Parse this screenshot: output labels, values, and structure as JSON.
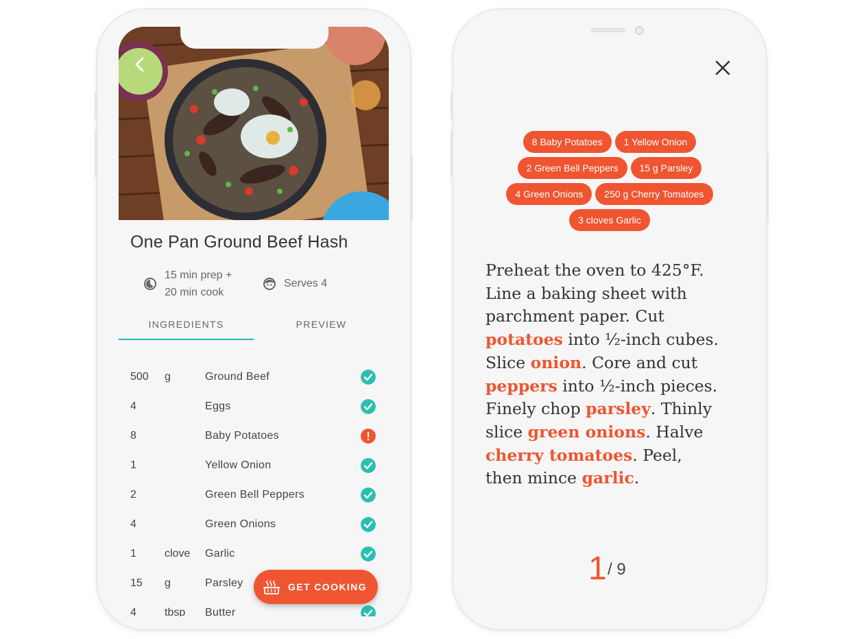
{
  "colors": {
    "accent": "#ef5530",
    "teal": "#2bbfb2"
  },
  "recipe": {
    "title": "One Pan Ground Beef Hash",
    "time_line1": "15 min prep +",
    "time_line2": "20 min cook",
    "serves": "Serves 4",
    "tabs": [
      {
        "label": "INGREDIENTS",
        "active": true
      },
      {
        "label": "PREVIEW",
        "active": false
      }
    ],
    "ingredients": [
      {
        "qty": "500",
        "unit": "g",
        "name": "Ground Beef",
        "status": "ok"
      },
      {
        "qty": "4",
        "unit": "",
        "name": "Eggs",
        "status": "ok"
      },
      {
        "qty": "8",
        "unit": "",
        "name": "Baby Potatoes",
        "status": "warn"
      },
      {
        "qty": "1",
        "unit": "",
        "name": "Yellow Onion",
        "status": "ok"
      },
      {
        "qty": "2",
        "unit": "",
        "name": "Green Bell Peppers",
        "status": "ok"
      },
      {
        "qty": "4",
        "unit": "",
        "name": "Green Onions",
        "status": "ok"
      },
      {
        "qty": "1",
        "unit": "clove",
        "name": "Garlic",
        "status": "ok"
      },
      {
        "qty": "15",
        "unit": "g",
        "name": "Parsley",
        "status": "ok"
      },
      {
        "qty": "4",
        "unit": "tbsp",
        "name": "Butter",
        "status": "ok"
      }
    ],
    "cta": "GET COOKING"
  },
  "step": {
    "chips": [
      [
        "8 Baby Potatoes",
        "1 Yellow Onion"
      ],
      [
        "2 Green Bell Peppers",
        "15 g Parsley"
      ],
      [
        "4 Green Onions",
        "250 g Cherry Tomatoes"
      ],
      [
        "3 cloves Garlic"
      ]
    ],
    "text": {
      "t1": "Preheat the oven to 425°F. Line a baking sheet with parchment paper. Cut ",
      "h1": "potatoes",
      "t2": " into ½-inch cubes. Slice ",
      "h2": "onion",
      "t3": ". Core and cut ",
      "h3": "peppers",
      "t4": " into ½-inch pieces. Finely chop ",
      "h4": "parsley",
      "t5": ". Thinly slice ",
      "h5": "green onions",
      "t6": ". Halve ",
      "h6": "cherry tomatoes",
      "t7": ". Peel, then mince ",
      "h7": "garlic",
      "t8": "."
    },
    "current": "1",
    "total": "/ 9"
  }
}
